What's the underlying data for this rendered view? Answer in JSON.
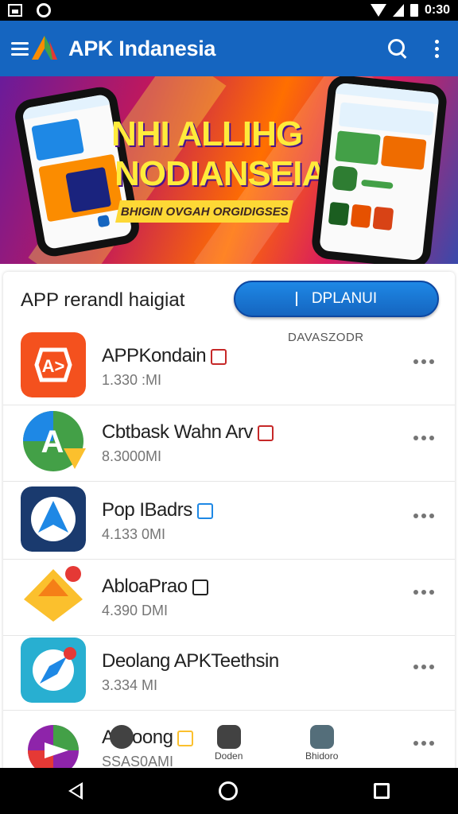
{
  "status_bar": {
    "time": "0:30",
    "icons": [
      "image-icon",
      "sync-icon",
      "wifi-icon",
      "signal-icon",
      "battery-icon"
    ]
  },
  "app_bar": {
    "title": "APK Indanesia",
    "icons": [
      "menu-icon",
      "logo-icon",
      "search-icon",
      "more-icon"
    ]
  },
  "banner": {
    "headline_line1": "NHI ALLIHG",
    "headline_line2": "NODIANSEIA",
    "ribbon": "BHIGIN OVGAH ORGIDIGSES"
  },
  "section": {
    "title": "APP rerandl haigiat",
    "download_button": "DPLANUI",
    "sort_label": "DAVASZODR"
  },
  "apps": [
    {
      "name": "APPKondain",
      "size": "1.330 :MI",
      "icon": "play-icon"
    },
    {
      "name": "Cbtbask Wahn Arv",
      "size": "8.3000MI",
      "icon": "store-icon"
    },
    {
      "name": "Pop IBadrs",
      "size": "4.133 0MI",
      "icon": "arrow-icon"
    },
    {
      "name": "AbloaPrao",
      "size": "4.390 DMI",
      "icon": "crown-icon"
    },
    {
      "name": "Deolang APKTeethsin",
      "size": "3.334 MI",
      "icon": "compass-icon"
    },
    {
      "name": "Ablioong",
      "size": "SSAS0AMI",
      "icon": "share-icon"
    }
  ],
  "bottom_nav": [
    {
      "label": "",
      "icon": "library-icon"
    },
    {
      "label": "Doden",
      "icon": "download-icon"
    },
    {
      "label": "Bhidoro",
      "icon": "chart-icon"
    }
  ],
  "colors": {
    "app_bar": "#1565c0",
    "download_button": "#1e88e5",
    "banner_text": "#ffeb3b"
  }
}
